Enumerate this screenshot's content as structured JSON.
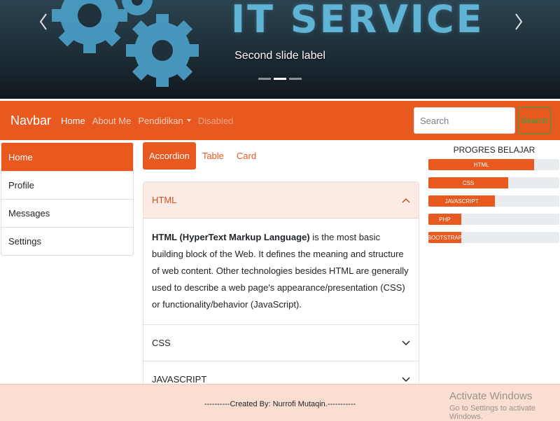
{
  "carousel": {
    "hero_text": "IT SERVICE",
    "caption": "Second slide label",
    "indicator_count": 3,
    "active_indicator": 2
  },
  "navbar": {
    "brand": "Navbar",
    "links": {
      "home": "Home",
      "about": "About Me",
      "pendidikan": "Pendidikan",
      "disabled": "Disabled"
    },
    "search_placeholder": "Search",
    "search_button": "Search",
    "accent_color": "#e8591f",
    "button_color": "#28a745"
  },
  "sidebar": {
    "items": [
      {
        "label": "Home",
        "active": true
      },
      {
        "label": "Profile"
      },
      {
        "label": "Messages"
      },
      {
        "label": "Settings"
      }
    ]
  },
  "tabs": [
    "Accordion",
    "Table",
    "Card"
  ],
  "accordion": {
    "items": [
      {
        "title": "HTML",
        "open": true
      },
      {
        "title": "CSS",
        "open": false
      },
      {
        "title": "JAVASCRIPT",
        "open": false
      }
    ],
    "body_strong": "HTML (HyperText Markup Language)",
    "body_text": " is the most basic building block of the Web. It defines the meaning and structure of web content. Other technologies besides HTML are generally used to describe a web page's appearance/presentation (CSS) or functionality/behavior (JavaScript)."
  },
  "progress": {
    "title": "PROGRES BELAJAR",
    "items": [
      {
        "label": "HTML",
        "percent": 81
      },
      {
        "label": "CSS",
        "percent": 61
      },
      {
        "label": "JAVASCRIPT",
        "percent": 51
      },
      {
        "label": "PHP",
        "percent": 25
      },
      {
        "label": "BOOTSTRAP",
        "percent": 25
      }
    ]
  },
  "footer": {
    "text": "----------Created By: Nurrofi Mutaqin.-----------"
  },
  "watermark": {
    "title": "Activate Windows",
    "subtitle": "Go to Settings to activate Windows."
  }
}
